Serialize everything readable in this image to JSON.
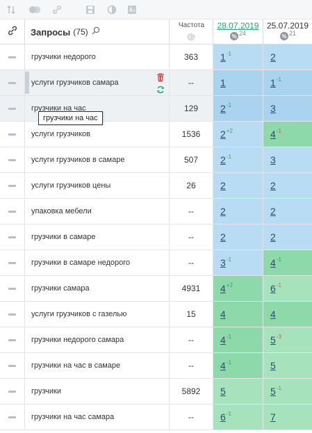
{
  "toolbar": {
    "icons": [
      "sort-icon",
      "toggle-icon",
      "link-icon",
      "save-icon",
      "contrast-icon",
      "text-format-icon"
    ]
  },
  "header": {
    "queries_title": "Запросы",
    "queries_count": "(75)",
    "frequency_label": "Частота",
    "dates": [
      {
        "date": "28.07.2019",
        "count": "24",
        "active": true
      },
      {
        "date": "25.07.2019",
        "count": "21",
        "active": false
      }
    ]
  },
  "tooltip": {
    "text": "грузчики на час"
  },
  "colors": {
    "accent_green": "#2aa66a",
    "delta_down": "#e05050",
    "cell_blue": "#aad3f0",
    "cell_green": "#8ed9aa"
  },
  "rows": [
    {
      "query": "грузчики недорого",
      "freq": "363",
      "p1": "1",
      "d1": "-1",
      "p2": "2",
      "d2": ""
    },
    {
      "query": "услуги грузчиков самара",
      "freq": "--",
      "p1": "1",
      "d1": "",
      "p2": "1",
      "d2": "-1"
    },
    {
      "query": "грузчики на час",
      "freq": "129",
      "p1": "2",
      "d1": "-1",
      "p2": "3",
      "d2": ""
    },
    {
      "query": "услуги грузчиков",
      "freq": "1536",
      "p1": "2",
      "d1": "+2",
      "p2": "4",
      "d2": "-1"
    },
    {
      "query": "услуги грузчиков в самаре",
      "freq": "507",
      "p1": "2",
      "d1": "-1",
      "p2": "3",
      "d2": ""
    },
    {
      "query": "услуги грузчиков цены",
      "freq": "26",
      "p1": "2",
      "d1": "",
      "p2": "2",
      "d2": ""
    },
    {
      "query": "упаковка мебели",
      "freq": "--",
      "p1": "2",
      "d1": "",
      "p2": "2",
      "d2": ""
    },
    {
      "query": "грузчики в самаре",
      "freq": "--",
      "p1": "2",
      "d1": "",
      "p2": "2",
      "d2": ""
    },
    {
      "query": "грузчики в самаре недорого",
      "freq": "--",
      "p1": "3",
      "d1": "-1",
      "p2": "4",
      "d2": "-1"
    },
    {
      "query": "грузчики самара",
      "freq": "4931",
      "p1": "4",
      "d1": "+2",
      "p2": "6",
      "d2": "-1"
    },
    {
      "query": "услуги грузчиков с газелью",
      "freq": "15",
      "p1": "4",
      "d1": "",
      "p2": "4",
      "d2": ""
    },
    {
      "query": "грузчики недорого самара",
      "freq": "--",
      "p1": "4",
      "d1": "-1",
      "p2": "5",
      "d2": "-3"
    },
    {
      "query": "грузчики на час в самаре",
      "freq": "--",
      "p1": "4",
      "d1": "-1",
      "p2": "5",
      "d2": ""
    },
    {
      "query": "грузчики",
      "freq": "5892",
      "p1": "5",
      "d1": "",
      "p2": "5",
      "d2": "-1"
    },
    {
      "query": "грузчики на час самара",
      "freq": "--",
      "p1": "6",
      "d1": "-1",
      "p2": "7",
      "d2": ""
    }
  ]
}
